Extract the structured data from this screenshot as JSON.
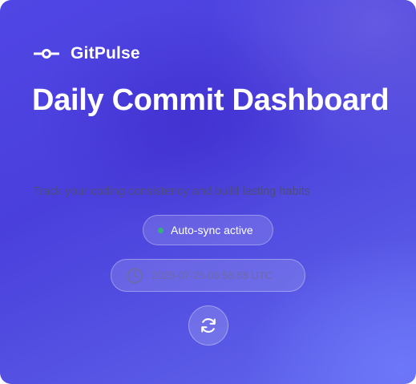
{
  "brand": {
    "name": "GitPulse",
    "icon": "git-commit-icon"
  },
  "header": {
    "title": "Daily Commit Dashboard",
    "subtitle": "Track your coding consistency and build lasting habits"
  },
  "status": {
    "label": "Auto-sync active",
    "dot_color": "#33b27a"
  },
  "timestamp": {
    "icon": "clock-icon",
    "value": "2025-07-25 06:58:58 UTC"
  },
  "refresh": {
    "icon": "refresh-icon"
  },
  "colors": {
    "gradient_start": "#5046e5",
    "gradient_end": "#6268ee",
    "text": "#ffffff"
  }
}
